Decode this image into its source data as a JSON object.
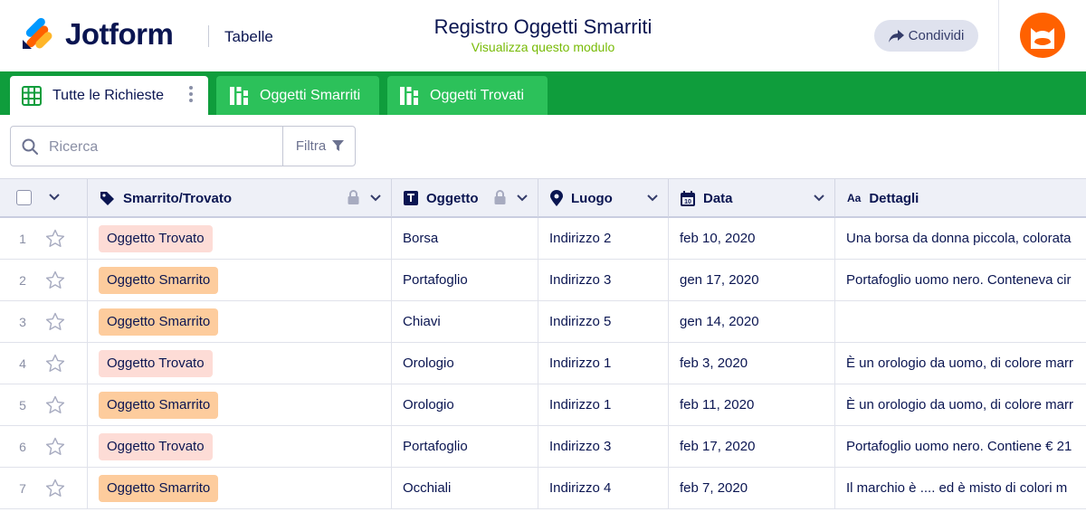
{
  "header": {
    "brand": "Jotform",
    "app_name": "Tabelle",
    "form_title": "Registro Oggetti Smarriti",
    "form_subtitle": "Visualizza questo modulo",
    "share_label": "Condividi",
    "colors": {
      "brand_blue": "#0a1551",
      "subtitle_green": "#78bb07",
      "avatar_orange": "#ff6100"
    }
  },
  "tabs": [
    {
      "label": "Tutte le Richieste",
      "icon": "grid-icon",
      "active": true
    },
    {
      "label": "Oggetti Smarriti",
      "icon": "report-icon",
      "active": false
    },
    {
      "label": "Oggetti Trovati",
      "icon": "report-icon",
      "active": false
    }
  ],
  "toolbar": {
    "search_placeholder": "Ricerca",
    "search_value": "",
    "filter_label": "Filtra"
  },
  "table": {
    "columns": [
      {
        "label": "Smarrito/Trovato",
        "icon": "tag-icon",
        "locked": true
      },
      {
        "label": "Oggetto",
        "icon": "text-icon",
        "locked": true
      },
      {
        "label": "Luogo",
        "icon": "location-icon",
        "locked": false
      },
      {
        "label": "Data",
        "icon": "calendar-icon",
        "locked": false
      },
      {
        "label": "Dettagli",
        "icon": "font-icon",
        "locked": false
      }
    ],
    "rows": [
      {
        "num": "1",
        "status": "Oggetto Trovato",
        "status_type": "found",
        "item": "Borsa",
        "place": "Indirizzo 2",
        "date": "feb 10, 2020",
        "details": "Una borsa da donna piccola, colorata"
      },
      {
        "num": "2",
        "status": "Oggetto Smarrito",
        "status_type": "lost",
        "item": "Portafoglio",
        "place": "Indirizzo 3",
        "date": "gen 17, 2020",
        "details": "Portafoglio uomo nero. Conteneva cir"
      },
      {
        "num": "3",
        "status": "Oggetto Smarrito",
        "status_type": "lost",
        "item": "Chiavi",
        "place": "Indirizzo 5",
        "date": "gen 14, 2020",
        "details": ""
      },
      {
        "num": "4",
        "status": "Oggetto Trovato",
        "status_type": "found",
        "item": "Orologio",
        "place": "Indirizzo 1",
        "date": "feb 3, 2020",
        "details": "È un orologio da uomo, di colore marr"
      },
      {
        "num": "5",
        "status": "Oggetto Smarrito",
        "status_type": "lost",
        "item": "Orologio",
        "place": "Indirizzo 1",
        "date": "feb 11, 2020",
        "details": "È un orologio da uomo, di colore marr"
      },
      {
        "num": "6",
        "status": "Oggetto Trovato",
        "status_type": "found",
        "item": "Portafoglio",
        "place": "Indirizzo 3",
        "date": "feb 17, 2020",
        "details": "Portafoglio uomo nero. Contiene € 21"
      },
      {
        "num": "7",
        "status": "Oggetto Smarrito",
        "status_type": "lost",
        "item": "Occhiali",
        "place": "Indirizzo 4",
        "date": "feb 7, 2020",
        "details": "Il marchio è .... ed è misto di colori m"
      }
    ],
    "badge_colors": {
      "found": "#fddcd6",
      "lost": "#fdcc9d"
    }
  }
}
